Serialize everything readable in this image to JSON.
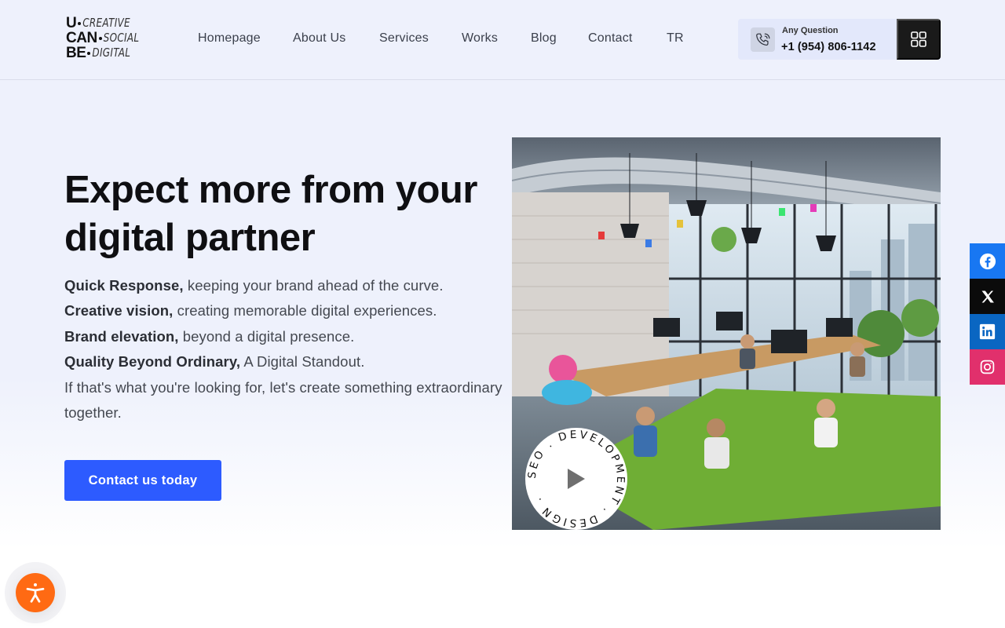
{
  "brand": {
    "line1_bold": "U",
    "line1_text": "CREATIVE",
    "line2_bold": "CAN",
    "line2_text": "SOCIAL",
    "line3_bold": "BE",
    "line3_text": "DIGITAL"
  },
  "nav": {
    "items": [
      {
        "label": "Homepage"
      },
      {
        "label": "About Us"
      },
      {
        "label": "Services"
      },
      {
        "label": "Works"
      },
      {
        "label": "Blog"
      },
      {
        "label": "Contact"
      },
      {
        "label": "TR"
      }
    ]
  },
  "header_contact": {
    "caption": "Any Question",
    "phone": "+1 (954) 806-1142",
    "icon": "phone-icon"
  },
  "menu_button": {
    "icon": "grid-menu-icon"
  },
  "hero": {
    "title": "Expect more from your digital partner",
    "lines": [
      {
        "bold": "Quick Response,",
        "text": " keeping your brand ahead of the curve."
      },
      {
        "bold": "Creative vision,",
        "text": " creating memorable digital experiences."
      },
      {
        "bold": "Brand elevation,",
        "text": " beyond a digital presence."
      },
      {
        "bold": "Quality Beyond Ordinary,",
        "text": " A Digital Standout."
      }
    ],
    "closing": "If that's what you're looking for, let's create something extraordinary together.",
    "cta_label": "Contact us today"
  },
  "video_badge": {
    "ring_text": "SEO . DEVELOPMENT . DESIGN . ",
    "icon": "play-icon"
  },
  "social": [
    {
      "name": "facebook",
      "icon": "facebook-icon",
      "color": "#1877f2"
    },
    {
      "name": "x",
      "icon": "x-icon",
      "color": "#0b0b0b"
    },
    {
      "name": "linkedin",
      "icon": "linkedin-icon",
      "color": "#0a66c2"
    },
    {
      "name": "instagram",
      "icon": "instagram-icon",
      "color": "#e1306c"
    }
  ],
  "accessibility": {
    "icon": "accessibility-icon",
    "color": "#ff6a13"
  },
  "colors": {
    "accent": "#2d5bff",
    "header_bg": "#eef1fc",
    "dark": "#1a1a1a"
  }
}
